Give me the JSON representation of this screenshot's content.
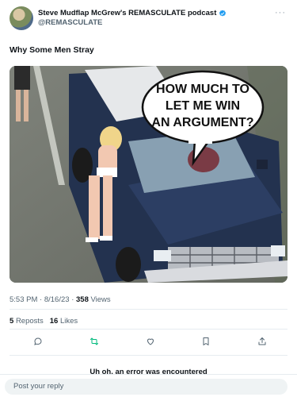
{
  "author": {
    "display_name": "Steve Mudflap McGrew's REMASCULATE podcast",
    "handle": "@REMASCULATE",
    "verified": true
  },
  "tweet": {
    "text": "Why Some Men Stray",
    "image_caption": "HOW MUCH TO LET ME WIN AN ARGUMENT?",
    "image_caption_lines": [
      "HOW MUCH TO",
      "LET ME WIN",
      "AN ARGUMENT?"
    ]
  },
  "meta": {
    "time": "5:53 PM",
    "date": "8/16/23",
    "separator": "·",
    "views_count": "358",
    "views_label": "Views"
  },
  "stats": {
    "reposts_count": "5",
    "reposts_label": "Reposts",
    "likes_count": "16",
    "likes_label": "Likes"
  },
  "actions": {
    "icons": [
      "reply-icon",
      "repost-icon",
      "like-icon",
      "bookmark-icon",
      "share-icon"
    ],
    "repost_color": "#00ba7c"
  },
  "status": {
    "error_text": "Uh oh, an error was encountered"
  },
  "reply": {
    "placeholder": "Post your reply"
  },
  "colors": {
    "verified": "#1d9bf0",
    "secondary_text": "#536471",
    "repost_green": "#00ba7c"
  }
}
